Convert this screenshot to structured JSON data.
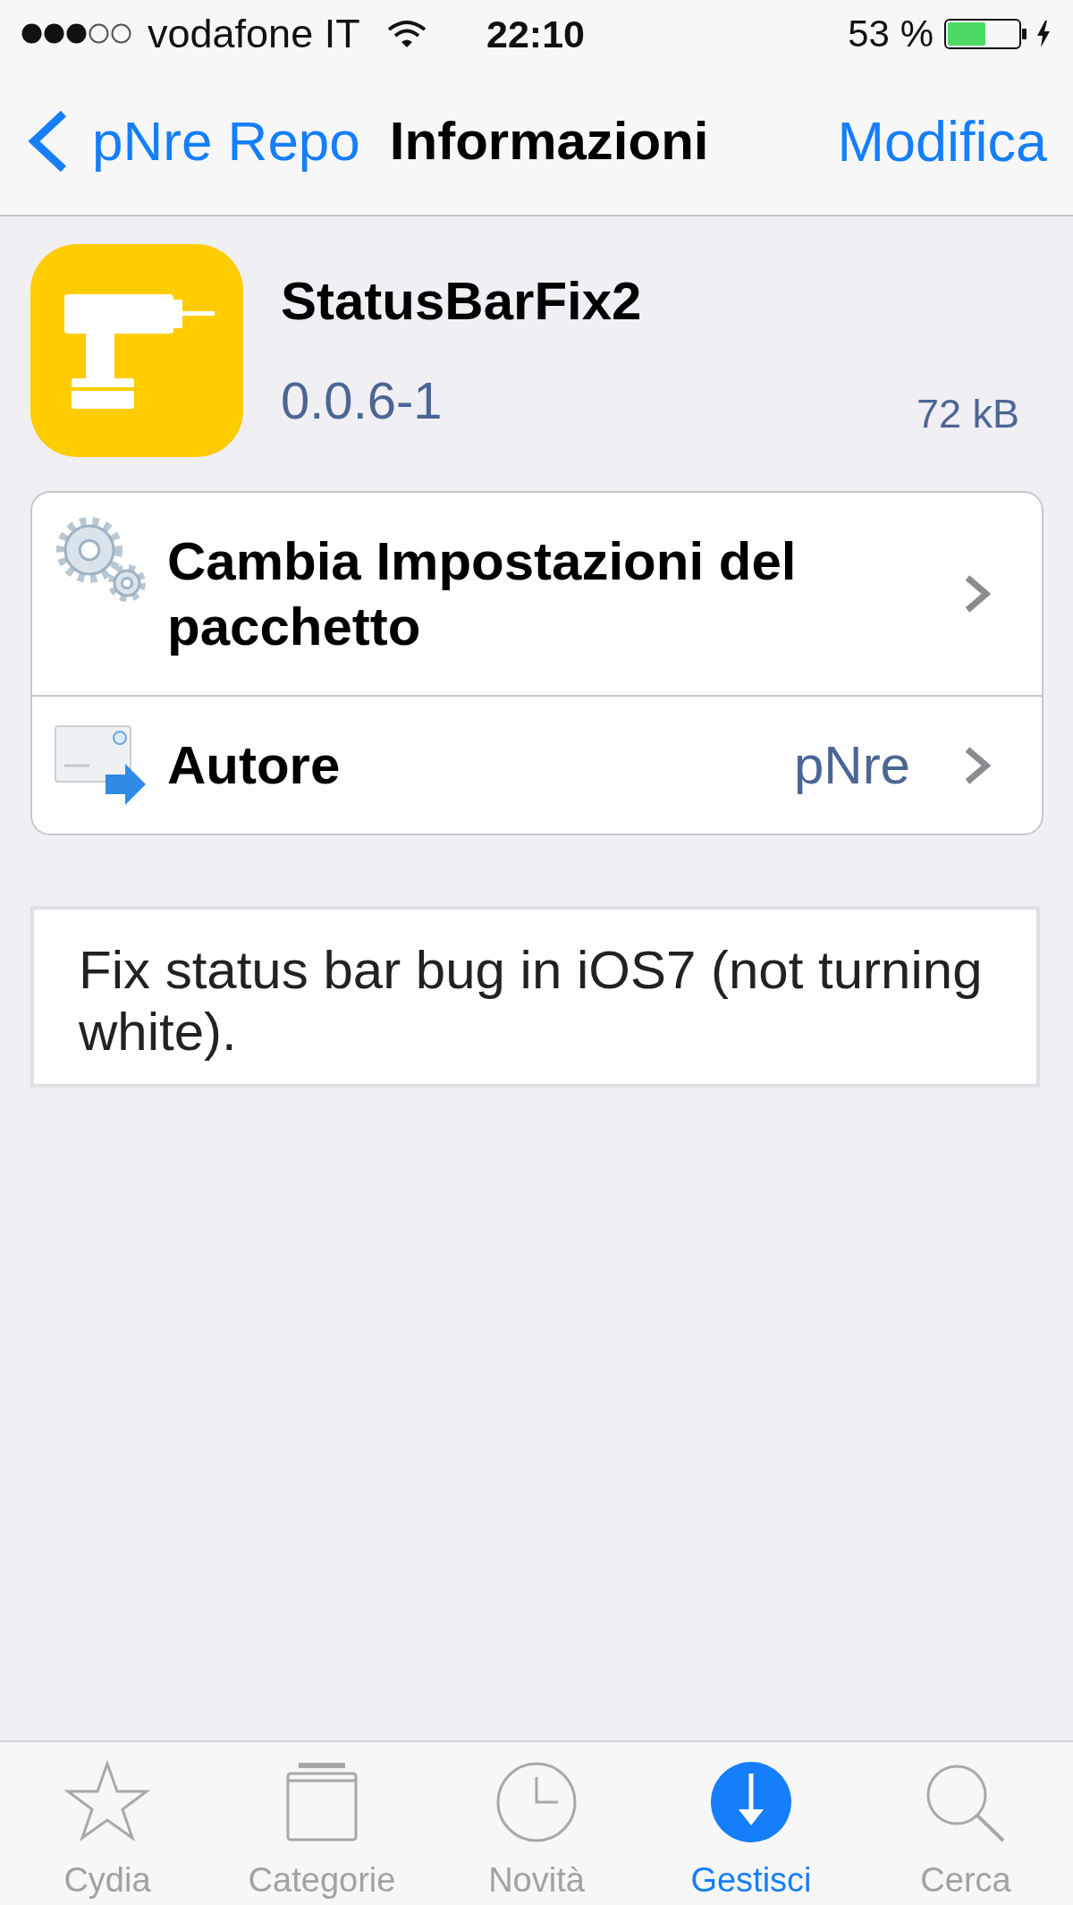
{
  "status_bar": {
    "carrier": "vodafone IT",
    "time": "22:10",
    "battery": "53 %"
  },
  "nav_bar": {
    "back": "pNre Repo",
    "title": "Informazioni",
    "action": "Modifica"
  },
  "package": {
    "name": "StatusBarFix2",
    "version": "0.0.6-1",
    "size": "72 kB"
  },
  "rows": [
    {
      "label": "Cambia Impostazioni del pacchetto"
    },
    {
      "label": "Autore",
      "value": "pNre"
    }
  ],
  "description": "Fix status bar bug in iOS7 (not turning white).",
  "tabs": [
    {
      "label": "Cydia",
      "selected": false
    },
    {
      "label": "Categorie",
      "selected": false
    },
    {
      "label": "Novità",
      "selected": false
    },
    {
      "label": "Gestisci",
      "selected": true
    },
    {
      "label": "Cerca",
      "selected": false
    }
  ]
}
